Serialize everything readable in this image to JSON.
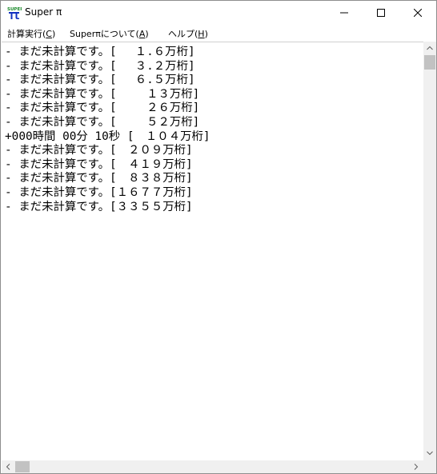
{
  "window": {
    "title": "Super π",
    "icon": "super-pi-icon",
    "controls": [
      "minimize-icon",
      "maximize-icon",
      "close-icon"
    ]
  },
  "menu": {
    "items": [
      {
        "label": "計算実行(",
        "accel": "C",
        "suffix": ")"
      },
      {
        "label": "Superπについて(",
        "accel": "A",
        "suffix": ")"
      },
      {
        "label": "ヘルプ(",
        "accel": "H",
        "suffix": ")"
      }
    ]
  },
  "output": {
    "lines": [
      "- まだ未計算です。[　 １.６万桁]",
      "- まだ未計算です。[　 ３.２万桁]",
      "- まだ未計算です。[　 ６.５万桁]",
      "- まだ未計算です。[　　 １３万桁]",
      "- まだ未計算です。[　　 ２６万桁]",
      "- まだ未計算です。[　　 ５２万桁]",
      "+000時間 00分 10秒 [　１０４万桁]",
      "- まだ未計算です。[　２０９万桁]",
      "- まだ未計算です。[　４１９万桁]",
      "- まだ未計算です。[　８３８万桁]",
      "- まだ未計算です。[１６７７万桁]",
      "- まだ未計算です。[３３５５万桁]"
    ]
  },
  "colors": {
    "background": "#ffffff",
    "text": "#000000",
    "scrollbar_track": "#f0f0f0",
    "scrollbar_thumb": "#c2c2c2",
    "icon_green": "#1a8a2a",
    "icon_blue": "#1030c0"
  }
}
